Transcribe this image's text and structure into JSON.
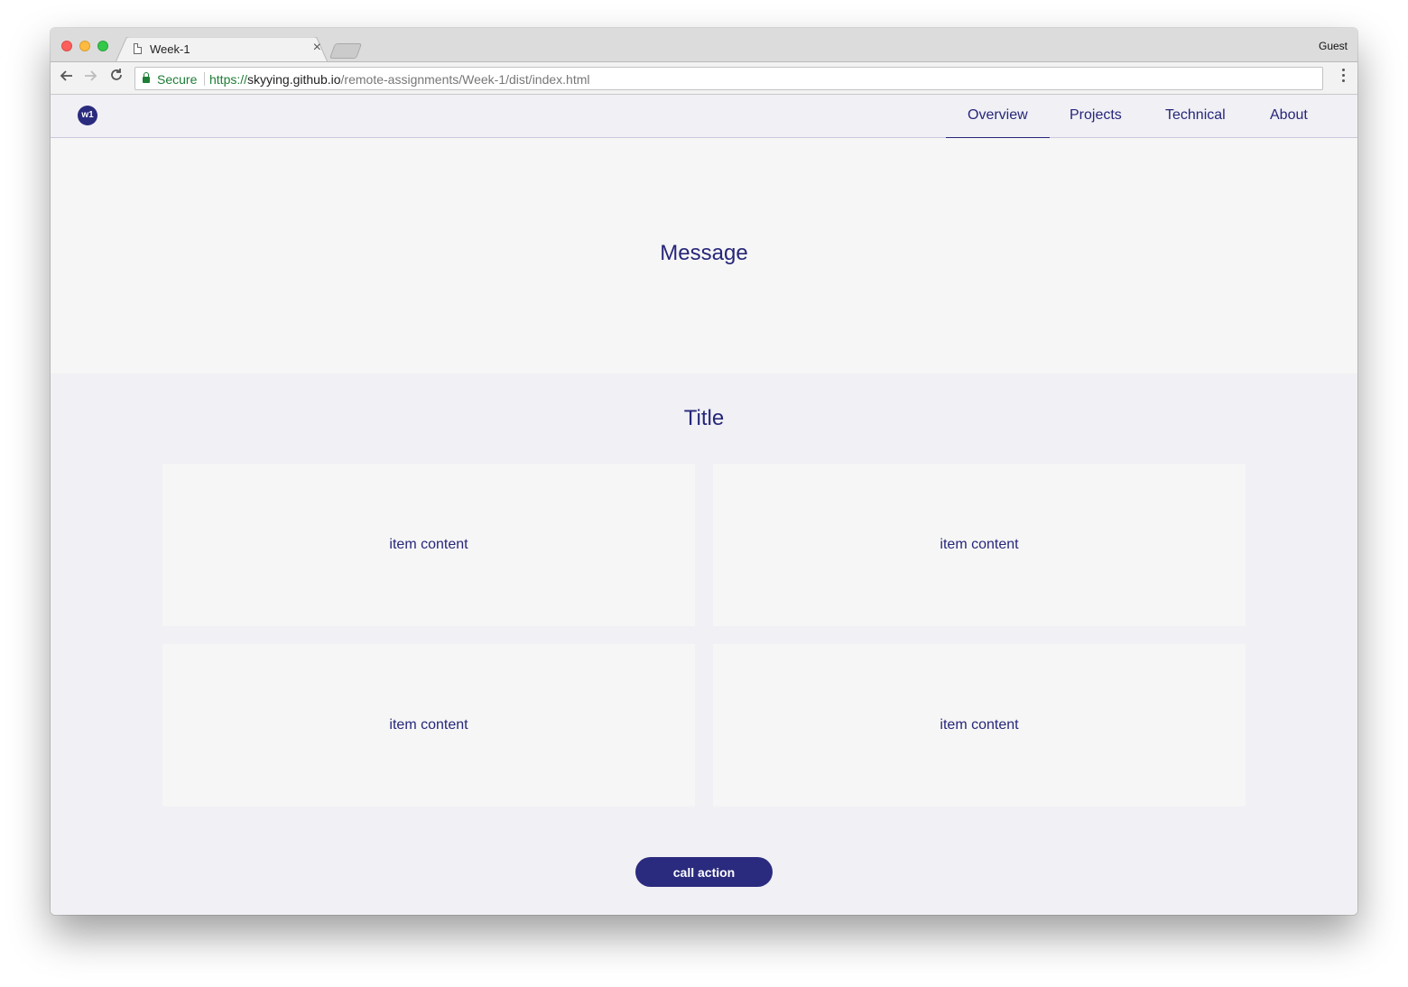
{
  "browser": {
    "tab_title": "Week-1",
    "tab_close": "×",
    "profile_label": "Guest",
    "secure_label": "Secure",
    "url_scheme": "https://",
    "url_host": "skyying.github.io",
    "url_path": "/remote-assignments/Week-1/dist/index.html"
  },
  "site": {
    "logo_text": "w1",
    "nav": [
      "Overview",
      "Projects",
      "Technical",
      "About"
    ],
    "active_nav": "Overview",
    "hero_message": "Message",
    "section_title": "Title",
    "items": [
      "item content",
      "item content",
      "item content",
      "item content"
    ],
    "cta_label": "call action",
    "colors": {
      "brand": "#2a2a7e",
      "page_bg": "#f0f0f5",
      "card_bg": "#f6f6f6"
    }
  }
}
